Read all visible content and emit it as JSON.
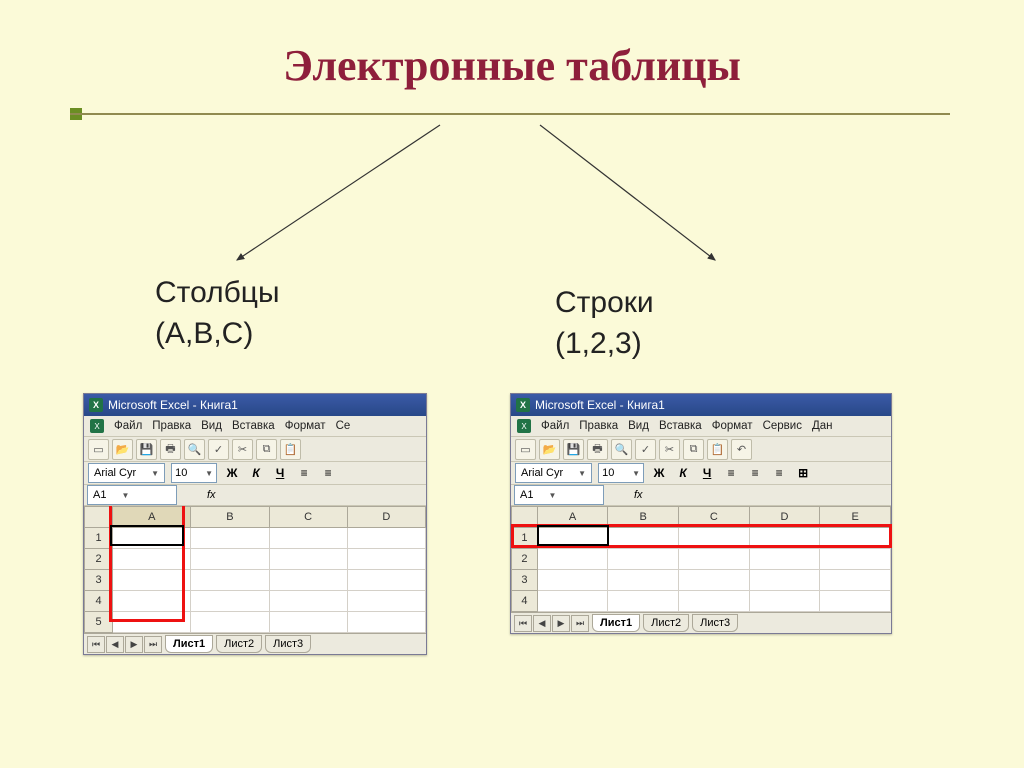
{
  "title": "Электронные таблицы",
  "left_label_line1": "Столбцы",
  "left_label_line2": "(A,B,C)",
  "right_label_line1": "Строки",
  "right_label_line2": "(1,2,3)",
  "window_title": "Microsoft Excel - Книга1",
  "menu": {
    "file": "Файл",
    "edit": "Правка",
    "view": "Вид",
    "insert": "Вставка",
    "format": "Формат",
    "tools_short": "Се",
    "tools": "Сервис",
    "data_short": "Дан"
  },
  "font_name": "Arial Cyr",
  "font_size": "10",
  "bold": "Ж",
  "italic": "К",
  "underline": "Ч",
  "cell_ref": "A1",
  "fx": "fx",
  "cols_left": [
    "A",
    "B",
    "C",
    "D"
  ],
  "rows_left": [
    "1",
    "2",
    "3",
    "4",
    "5"
  ],
  "cols_right": [
    "A",
    "B",
    "C",
    "D",
    "E"
  ],
  "rows_right": [
    "1",
    "2",
    "3",
    "4"
  ],
  "sheets": {
    "s1": "Лист1",
    "s2": "Лист2",
    "s3": "Лист3"
  }
}
